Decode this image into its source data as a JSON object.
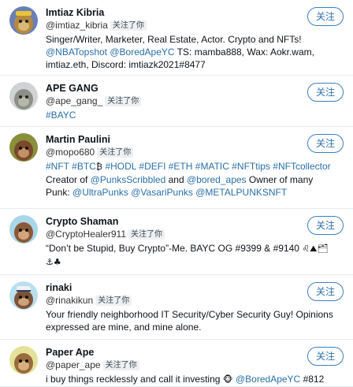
{
  "follow_label": "关注",
  "followed_badge": "关注了你",
  "users": [
    {
      "name": "Imtiaz Kibria",
      "handle": "@imtiaz_kibria",
      "avatar": "avatar-ape-gold",
      "bio_parts": [
        {
          "t": "Singer/Writer, Marketer, Real Estate, Actor. Crypto and NFTs! "
        },
        {
          "t": "@NBATopshot",
          "link": true
        },
        {
          "t": " "
        },
        {
          "t": "@BoredApeYC",
          "link": true
        },
        {
          "t": " TS: mamba888, Wax: Aokr.wam, imtiaz.eth, Discord: imtiazk2021#8477"
        }
      ]
    },
    {
      "name": "APE GANG",
      "handle": "@ape_gang_",
      "avatar": "avatar-ape-gray",
      "bio_parts": [
        {
          "t": "#BAYC",
          "link": true
        }
      ]
    },
    {
      "name": "Martin Paulini",
      "handle": "@mopo680",
      "avatar": "avatar-ape-olive",
      "bio_parts": [
        {
          "t": "#NFT",
          "link": true
        },
        {
          "t": " "
        },
        {
          "t": "#BTC",
          "link": true
        },
        {
          "t": "₿ ",
          "emoji": true
        },
        {
          "t": "#HODL",
          "link": true
        },
        {
          "t": " "
        },
        {
          "t": "#DEFI",
          "link": true
        },
        {
          "t": " "
        },
        {
          "t": "#ETH",
          "link": true
        },
        {
          "t": " "
        },
        {
          "t": "#MATIC",
          "link": true
        },
        {
          "t": " "
        },
        {
          "t": "#NFTtips",
          "link": true
        },
        {
          "t": " "
        },
        {
          "t": "#NFTcollector",
          "link": true
        },
        {
          "t": " Creator of "
        },
        {
          "t": "@PunksScribbled",
          "link": true
        },
        {
          "t": " and "
        },
        {
          "t": "@bored_apes",
          "link": true
        },
        {
          "t": " Owner of many Punk: "
        },
        {
          "t": "@UltraPunks",
          "link": true
        },
        {
          "t": " "
        },
        {
          "t": "@VasariPunks",
          "link": true
        },
        {
          "t": " "
        },
        {
          "t": "@METALPUNKSNFT",
          "link": true
        }
      ]
    },
    {
      "name": "Crypto Shaman",
      "handle": "@CryptoHealer911",
      "avatar": "avatar-ape-blue",
      "bio_parts": [
        {
          "t": "“Don’t be Stupid, Buy Crypto”-Me. BAYC OG #9399 & #9140 "
        },
        {
          "t": "♌⛰🗂 ⚓♣",
          "emoji": true
        }
      ]
    },
    {
      "name": "rinaki",
      "handle": "@rinakikun",
      "avatar": "avatar-ape-sailor",
      "bio_parts": [
        {
          "t": "Your friendly neighborhood IT Security/Cyber Security Guy! Opinions expressed are mine, and mine alone."
        }
      ]
    },
    {
      "name": "Paper Ape",
      "handle": "@paper_ape",
      "avatar": "avatar-ape-yellow",
      "bio_parts": [
        {
          "t": "i buy things recklessly and call it investing "
        },
        {
          "t": "🐵 ",
          "emoji": true
        },
        {
          "t": "@BoredApeYC",
          "link": true
        },
        {
          "t": " #812"
        }
      ]
    }
  ]
}
